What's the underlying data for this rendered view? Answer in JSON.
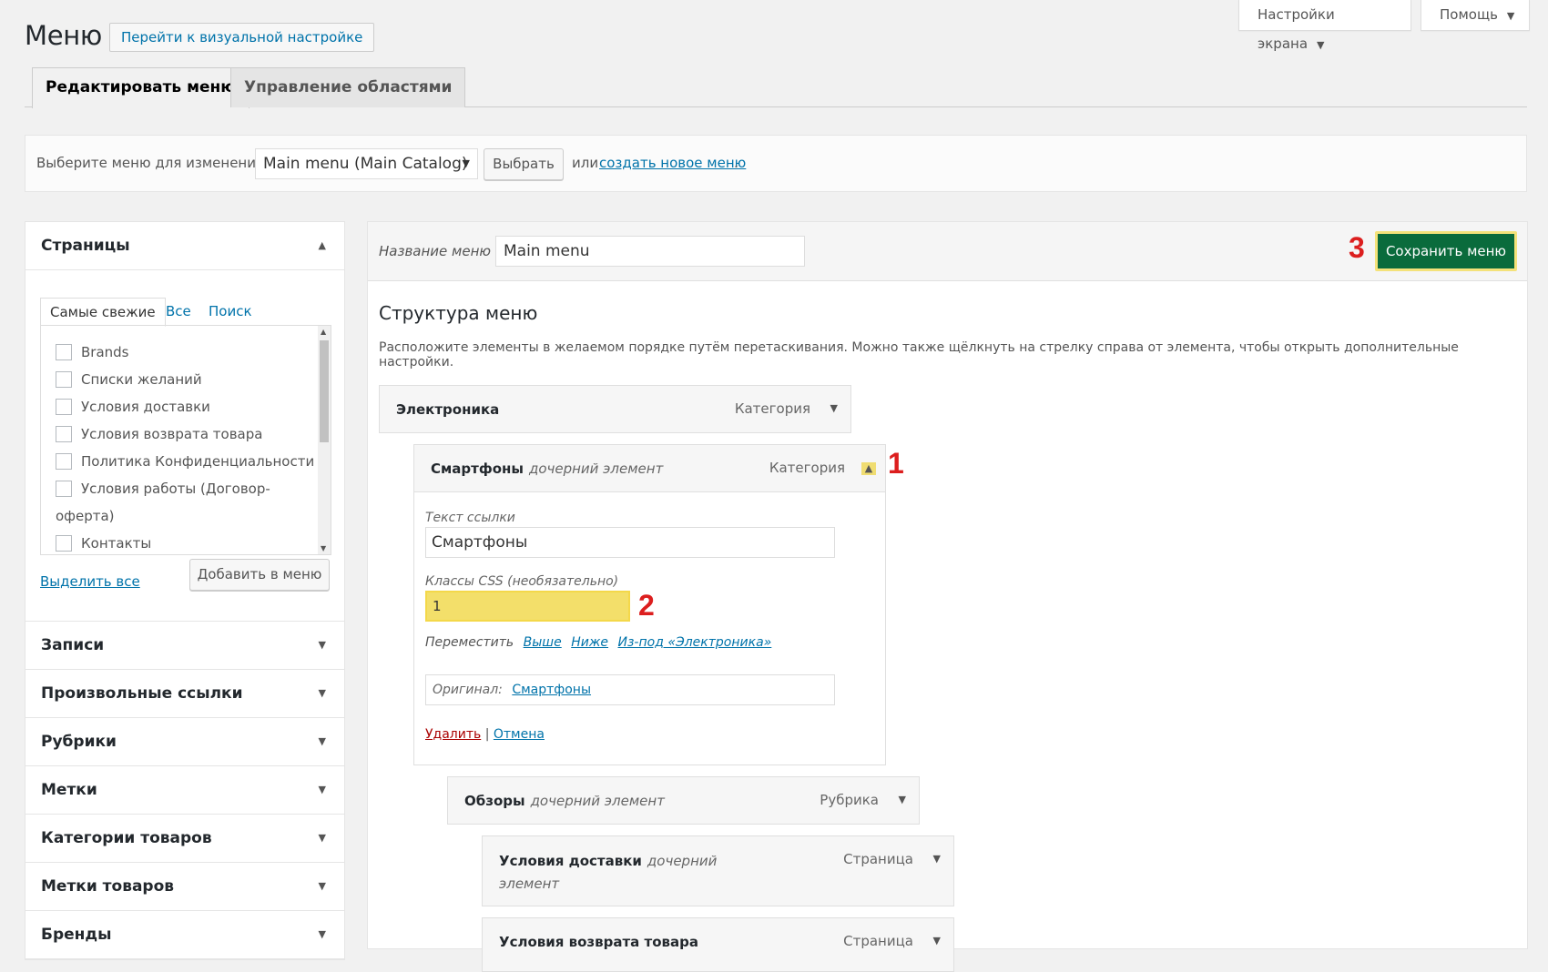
{
  "header": {
    "title": "Меню",
    "visual_button": "Перейти к визуальной настройке",
    "screen_options": "Настройки экрана",
    "help": "Помощь"
  },
  "tabs": [
    {
      "label": "Редактировать меню",
      "active": true
    },
    {
      "label": "Управление областями",
      "active": false
    }
  ],
  "manage": {
    "label": "Выберите меню для изменения:",
    "selected": "Main menu (Main Catalog)",
    "select_button": "Выбрать",
    "or": "или",
    "create_link": "создать новое меню",
    "dot": "."
  },
  "sidebar": {
    "pages": {
      "title": "Страницы",
      "tabs": [
        "Самые свежие",
        "Все",
        "Поиск"
      ],
      "items": [
        "Brands",
        "Списки желаний",
        "Условия доставки",
        "Условия возврата товара",
        "Политика Конфиденциальности",
        "Условия работы (Договор-оферта)",
        "Контакты"
      ],
      "select_all": "Выделить все",
      "add_button": "Добавить в меню"
    },
    "sections": [
      "Записи",
      "Произвольные ссылки",
      "Рубрики",
      "Метки",
      "Категории товаров",
      "Метки товаров",
      "Бренды"
    ]
  },
  "editor": {
    "name_label": "Название меню",
    "name_value": "Main menu",
    "save_button": "Сохранить меню",
    "structure_title": "Структура меню",
    "structure_desc": "Расположите элементы в желаемом порядке путём перетаскивания. Можно также щёлкнуть на стрелку справа от элемента, чтобы открыть дополнительные настройки.",
    "items": [
      {
        "title": "Электроника",
        "sub": "",
        "type": "Категория"
      },
      {
        "title": "Смартфоны",
        "sub": "дочерний элемент",
        "type": "Категория"
      },
      {
        "title": "Обзоры",
        "sub": "дочерний элемент",
        "type": "Рубрика"
      },
      {
        "title": "Условия доставки",
        "sub": "дочерний элемент",
        "type": "Страница"
      },
      {
        "title": "Условия возврата товара",
        "sub": "",
        "type": "Страница"
      }
    ],
    "settings": {
      "link_text_label": "Текст ссылки",
      "link_text_value": "Смартфоны",
      "css_label": "Классы CSS (необязательно)",
      "css_value": "1",
      "move_label": "Переместить",
      "move_up": "Выше",
      "move_down": "Ниже",
      "move_out": "Из-под «Электроника»",
      "original_label": "Оригинал:",
      "original_link": "Смартфоны",
      "delete": "Удалить",
      "sep": "|",
      "cancel": "Отмена"
    }
  },
  "markers": [
    "1",
    "2",
    "3"
  ],
  "icons": {
    "dropdown": "triangle-down-icon",
    "collapse": "triangle-up-icon",
    "checkbox": "checkbox-icon"
  },
  "colors": {
    "link": "#0073aa",
    "save_bg": "#0a6b3c",
    "highlight": "#f3df6a",
    "marker": "#dc1e1e",
    "delete": "#aa0000"
  }
}
